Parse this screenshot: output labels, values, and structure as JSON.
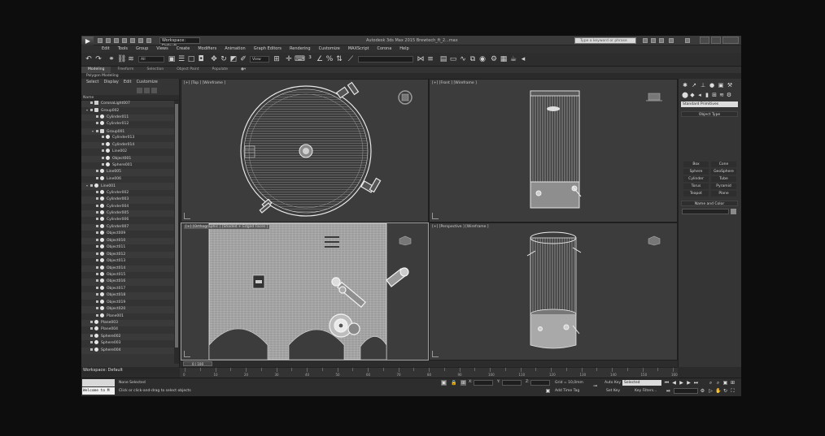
{
  "titlebar": {
    "workspace": "Workspace: Default",
    "title": "Autodesk 3ds Max 2015   Brewtech_ft_2...max",
    "search_placeholder": "Type a keyword or phrase"
  },
  "menus": [
    "Edit",
    "Tools",
    "Group",
    "Views",
    "Create",
    "Modifiers",
    "Animation",
    "Graph Editors",
    "Rendering",
    "Customize",
    "MAXScript",
    "Corona",
    "Help"
  ],
  "toolbar": {
    "selection_filter": "All",
    "reference_coord": "View"
  },
  "ribbon": {
    "tabs": [
      "Modeling",
      "Freeform",
      "Selection",
      "Object Paint",
      "Populate"
    ],
    "sub_label": "Polygon Modeling"
  },
  "explorer": {
    "menu": [
      "Select",
      "Display",
      "Edit",
      "Customize"
    ],
    "header": "Name",
    "items": [
      {
        "label": "CoronaLight007",
        "level": 0,
        "type": "light"
      },
      {
        "label": "Group002",
        "level": 0,
        "type": "group",
        "expanded": true
      },
      {
        "label": "Cylinder011",
        "level": 1,
        "type": "obj"
      },
      {
        "label": "Cylinder012",
        "level": 1,
        "type": "obj"
      },
      {
        "label": "Group001",
        "level": 1,
        "type": "group",
        "expanded": true
      },
      {
        "label": "Cylinder013",
        "level": 2,
        "type": "obj"
      },
      {
        "label": "Cylinder014",
        "level": 2,
        "type": "obj"
      },
      {
        "label": "Line002",
        "level": 2,
        "type": "obj"
      },
      {
        "label": "Object001",
        "level": 2,
        "type": "obj"
      },
      {
        "label": "Sphere001",
        "level": 2,
        "type": "obj"
      },
      {
        "label": "Line005",
        "level": 1,
        "type": "obj"
      },
      {
        "label": "Line006",
        "level": 1,
        "type": "obj"
      },
      {
        "label": "Line001",
        "level": 0,
        "type": "obj",
        "expanded": true
      },
      {
        "label": "Cylinder002",
        "level": 1,
        "type": "obj"
      },
      {
        "label": "Cylinder003",
        "level": 1,
        "type": "obj"
      },
      {
        "label": "Cylinder004",
        "level": 1,
        "type": "obj"
      },
      {
        "label": "Cylinder005",
        "level": 1,
        "type": "obj"
      },
      {
        "label": "Cylinder006",
        "level": 1,
        "type": "obj"
      },
      {
        "label": "Cylinder007",
        "level": 1,
        "type": "obj"
      },
      {
        "label": "Object009",
        "level": 1,
        "type": "obj"
      },
      {
        "label": "Object010",
        "level": 1,
        "type": "obj"
      },
      {
        "label": "Object011",
        "level": 1,
        "type": "obj"
      },
      {
        "label": "Object012",
        "level": 1,
        "type": "obj"
      },
      {
        "label": "Object013",
        "level": 1,
        "type": "obj"
      },
      {
        "label": "Object014",
        "level": 1,
        "type": "obj"
      },
      {
        "label": "Object015",
        "level": 1,
        "type": "obj"
      },
      {
        "label": "Object016",
        "level": 1,
        "type": "obj"
      },
      {
        "label": "Object017",
        "level": 1,
        "type": "obj"
      },
      {
        "label": "Object018",
        "level": 1,
        "type": "obj"
      },
      {
        "label": "Object019",
        "level": 1,
        "type": "obj"
      },
      {
        "label": "Object020",
        "level": 1,
        "type": "obj"
      },
      {
        "label": "Plane001",
        "level": 1,
        "type": "obj"
      },
      {
        "label": "Plane003",
        "level": 0,
        "type": "obj"
      },
      {
        "label": "Plane004",
        "level": 0,
        "type": "obj"
      },
      {
        "label": "Sphere002",
        "level": 0,
        "type": "obj"
      },
      {
        "label": "Sphere003",
        "level": 0,
        "type": "obj"
      },
      {
        "label": "Sphere004",
        "level": 0,
        "type": "obj"
      }
    ]
  },
  "viewports": {
    "top": "[+] [Top ] [Wireframe ]",
    "front": "[+] [Front ] [Wireframe ]",
    "ortho": "[+] [Orthographic ] [Shaded + Edged Faces ]",
    "perspective": "[+] [Perspective ] [Wireframe ]"
  },
  "command_panel": {
    "category": "Standard Primitives",
    "object_type_title": "Object Type",
    "object_types": [
      "Box",
      "Cone",
      "Sphere",
      "GeoSphere",
      "Cylinder",
      "Tube",
      "Torus",
      "Pyramid",
      "Teapot",
      "Plane"
    ],
    "name_color_title": "Name and Color"
  },
  "timeline": {
    "frame": "0 / 100",
    "ticks": [
      "0",
      "10",
      "20",
      "30",
      "40",
      "50",
      "60",
      "70",
      "80",
      "90",
      "100",
      "110",
      "120",
      "130",
      "140",
      "150",
      "160"
    ]
  },
  "workspace_bar": "Workspace: Default",
  "status": {
    "maxscript_text": "Welcome to M",
    "selection": "None Selected",
    "prompt": "Click or click-and-drag to select objects",
    "x_label": "X:",
    "y_label": "Y:",
    "z_label": "Z:",
    "grid": "Grid = 10,0mm",
    "add_time_tag": "Add Time Tag",
    "auto_key": "Auto Key",
    "key_mode": "Selected",
    "set_key": "Set Key",
    "key_filters": "Key Filters..."
  },
  "colors": {
    "bg": "#2b2b2b",
    "viewport": "#3c3c3c",
    "wire": "#e8e8e8"
  }
}
